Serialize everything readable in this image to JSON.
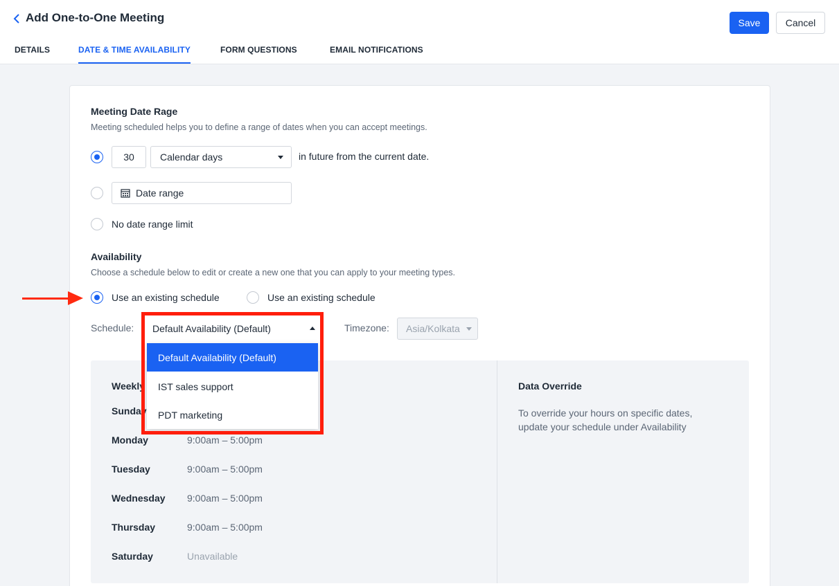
{
  "header": {
    "title": "Add One-to-One Meeting",
    "save_label": "Save",
    "cancel_label": "Cancel"
  },
  "tabs": [
    {
      "label": "DETAILS",
      "active": false
    },
    {
      "label": "DATE & TIME AVAILABILITY",
      "active": true
    },
    {
      "label": "FORM QUESTIONS",
      "active": false
    },
    {
      "label": "EMAIL NOTIFICATIONS",
      "active": false
    }
  ],
  "date_range": {
    "heading": "Meeting Date Rage",
    "description": "Meeting scheduled helps you to define a range of dates when you can accept meetings.",
    "days_value": "30",
    "unit_selected": "Calendar days",
    "suffix": "in future from the current date.",
    "date_range_label": "Date range",
    "no_limit_label": "No date range limit"
  },
  "availability": {
    "heading": "Availability",
    "description": "Choose a schedule below to edit or create a new one that you can apply to your meeting types.",
    "option_existing": "Use an existing schedule",
    "option_new": "Use an existing schedule",
    "schedule_label": "Schedule:",
    "schedule_selected": "Default Availability (Default)",
    "timezone_label": "Timezone:",
    "timezone_value": "Asia/Kolkata",
    "schedule_options": [
      "Default Availability (Default)",
      "IST sales support",
      "PDT marketing"
    ]
  },
  "weekly": {
    "heading": "Weekly",
    "days": [
      {
        "day": "Sunday",
        "hours": ""
      },
      {
        "day": "Monday",
        "hours": "9:00am – 5:00pm"
      },
      {
        "day": "Tuesday",
        "hours": "9:00am – 5:00pm"
      },
      {
        "day": "Wednesday",
        "hours": "9:00am – 5:00pm"
      },
      {
        "day": "Thursday",
        "hours": "9:00am – 5:00pm"
      },
      {
        "day": "Saturday",
        "hours": "Unavailable"
      }
    ]
  },
  "override": {
    "heading": "Data Override",
    "text": "To override your hours on specific dates, update your schedule under Availability"
  },
  "colors": {
    "accent": "#1a62f2",
    "annotation": "#ff1e0c"
  }
}
